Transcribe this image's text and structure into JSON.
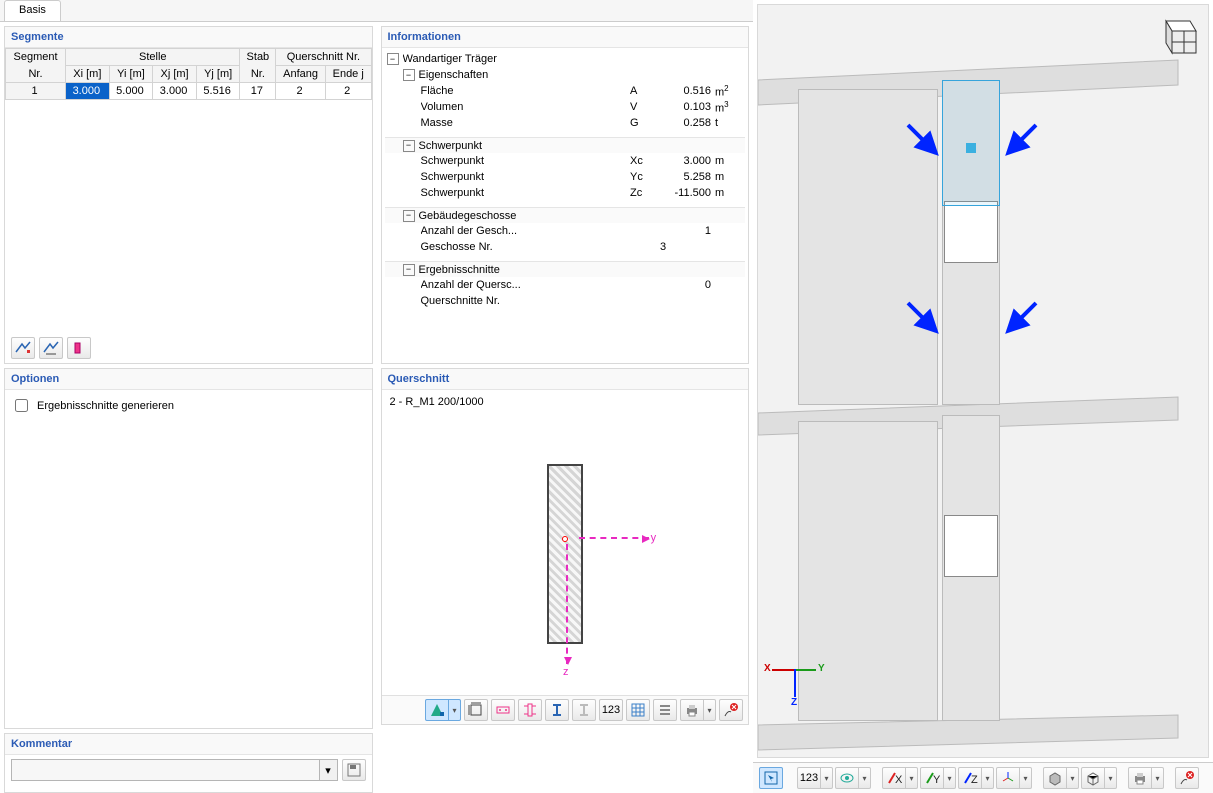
{
  "tab_basis": "Basis",
  "segmente": {
    "title": "Segmente",
    "headers": {
      "seg_nr1": "Segment",
      "seg_nr2": "Nr.",
      "stelle": "Stelle",
      "xi": "Xi [m]",
      "yi": "Yi [m]",
      "xj": "Xj [m]",
      "yj": "Yj [m]",
      "stab1": "Stab",
      "stab2": "Nr.",
      "qs": "Querschnitt Nr.",
      "anfang": "Anfang",
      "endej": "Ende j"
    },
    "row": {
      "nr": "1",
      "xi": "3.000",
      "yi": "5.000",
      "xj": "3.000",
      "yj": "5.516",
      "stab": "17",
      "qs_a": "2",
      "qs_e": "2"
    }
  },
  "optionen": {
    "title": "Optionen",
    "ergebnisschnitte": "Ergebnisschnitte generieren"
  },
  "info": {
    "title": "Informationen",
    "wand_tr": "Wandartiger Träger",
    "eigenschaften": "Eigenschaften",
    "flaeche": {
      "l": "Fläche",
      "s": "A",
      "v": "0.516",
      "u_html": "m<span class='sup'>2</span>"
    },
    "volumen": {
      "l": "Volumen",
      "s": "V",
      "v": "0.103",
      "u_html": "m<span class='sup'>3</span>"
    },
    "masse": {
      "l": "Masse",
      "s": "G",
      "v": "0.258",
      "u": "t"
    },
    "schwerpunkt": "Schwerpunkt",
    "sp_x": {
      "l": "Schwerpunkt",
      "s": "Xc",
      "v": "3.000",
      "u": "m"
    },
    "sp_y": {
      "l": "Schwerpunkt",
      "s": "Yc",
      "v": "5.258",
      "u": "m"
    },
    "sp_z": {
      "l": "Schwerpunkt",
      "s": "Zc",
      "v": "-11.500",
      "u": "m"
    },
    "geschosse": "Gebäudegeschosse",
    "g_anz": {
      "l": "Anzahl der Gesch...",
      "v": "1"
    },
    "g_nr": {
      "l": "Geschosse Nr.",
      "v": "3"
    },
    "erg": "Ergebnisschnitte",
    "e_anz": {
      "l": "Anzahl der Quersc...",
      "v": "0"
    },
    "e_nr": {
      "l": "Querschnitte Nr.",
      "v": ""
    }
  },
  "querschnitt": {
    "title": "Querschnitt",
    "name": "2 - R_M1 200/1000",
    "y": "y",
    "z": "z"
  },
  "kommentar": {
    "title": "Kommentar",
    "placeholder": ""
  },
  "axis": {
    "x": "X",
    "y": "Y",
    "z": "Z"
  }
}
